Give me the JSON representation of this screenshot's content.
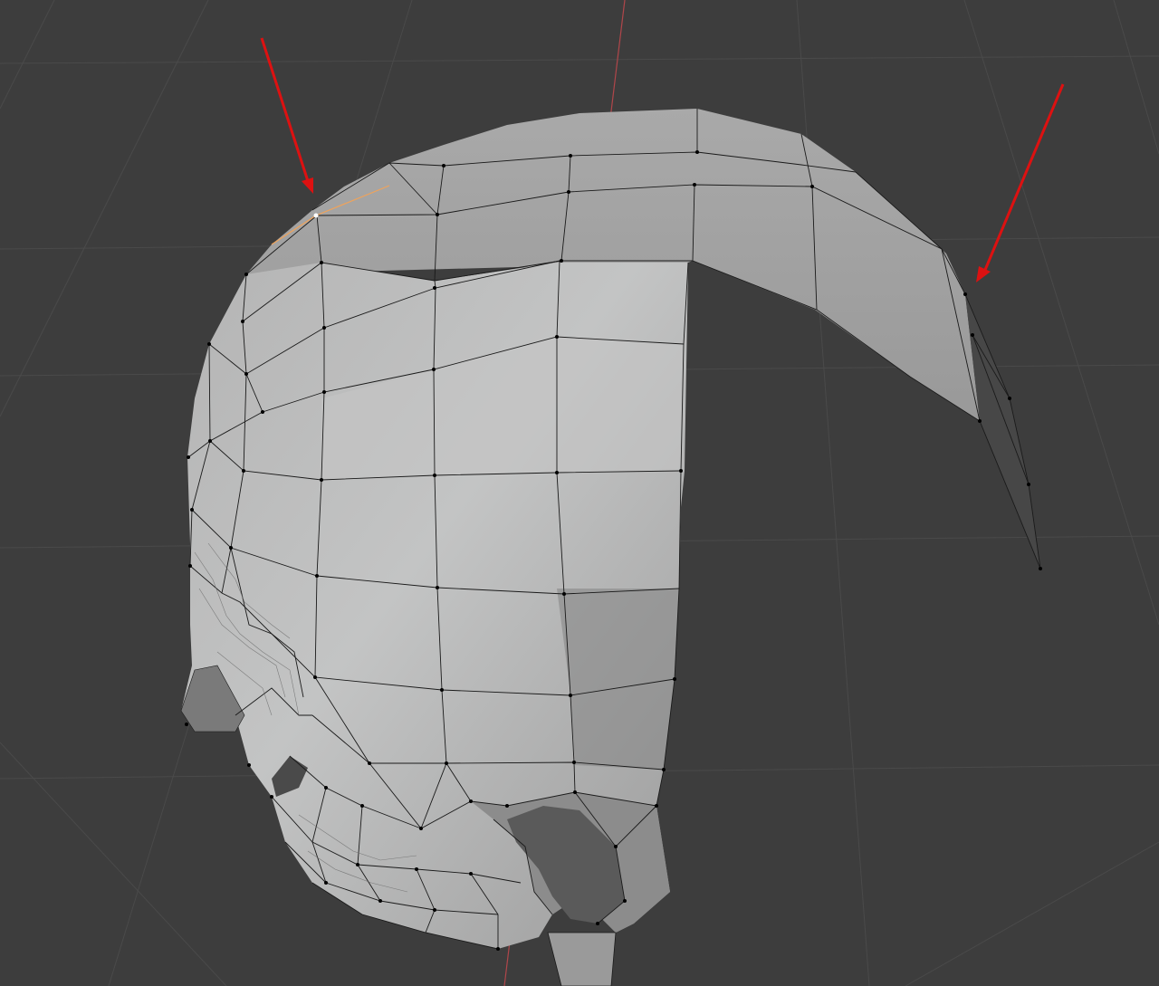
{
  "viewport": {
    "background_color": "#3d3d3d",
    "grid_color": "#4a4a4a",
    "axis_color": "#b0464a"
  },
  "mesh": {
    "object": "head",
    "mode": "edit",
    "face_light": "#b9b9b9",
    "face_mid": "#a4a4a4",
    "face_dark": "#8a8a8a",
    "edge_color": "#1a1a1a",
    "vertex_color": "#000000",
    "selected_edge_color": "#f0a35a"
  },
  "annotations": {
    "arrow_color": "#dd1111",
    "arrow_count": 2
  }
}
